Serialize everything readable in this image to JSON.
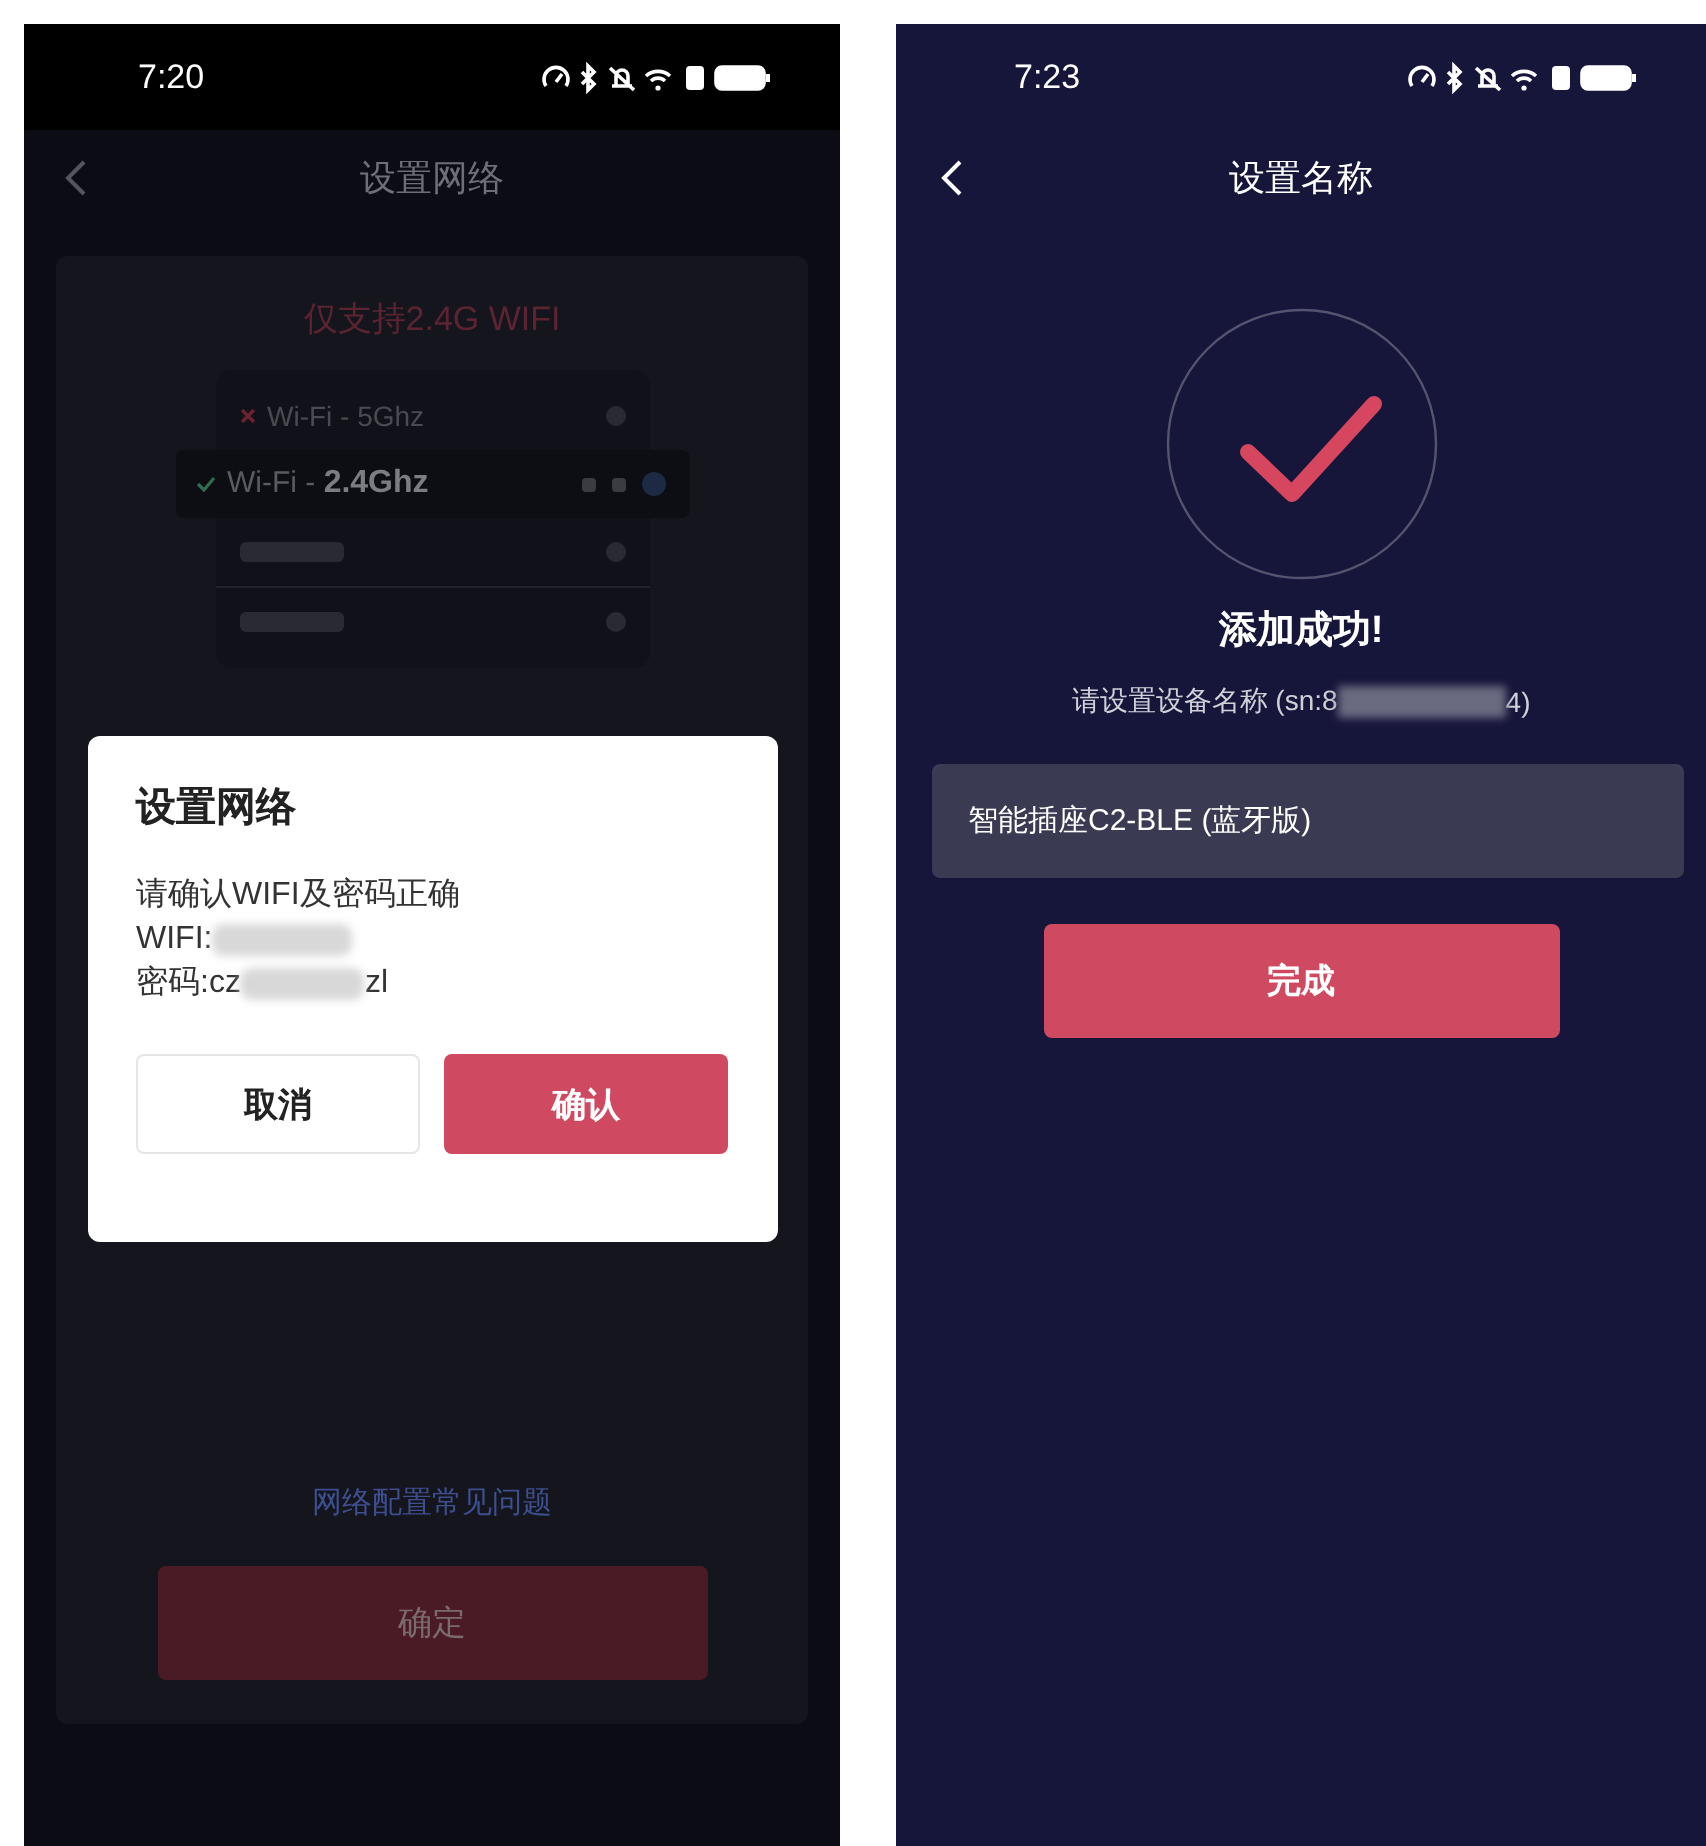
{
  "left_screen": {
    "status_bar": {
      "time": "7:20"
    },
    "header": {
      "title": "设置网络"
    },
    "notice": "仅支持2.4G WIFI",
    "wifi_list": [
      {
        "kind": "rejected",
        "label": "Wi-Fi - 5Ghz"
      },
      {
        "kind": "accepted",
        "label": "Wi-Fi - **2.4Ghz**"
      },
      {
        "kind": "blank"
      },
      {
        "kind": "blank"
      }
    ],
    "help_link": "网络配置常见问题",
    "submit_button": "确定",
    "dialog": {
      "title": "设置网络",
      "message": "请确认WIFI及密码正确",
      "wifi_label": "WIFI:",
      "password_start": "密码:cz",
      "password_end": "zl",
      "buttons": [
        {
          "kind": "secondary",
          "label": "取消"
        },
        {
          "kind": "primary",
          "label": "确认"
        }
      ]
    }
  },
  "right_screen": {
    "status_bar": {
      "time": "7:23"
    },
    "header": {
      "title": "设置名称"
    },
    "success_title": "添加成功!",
    "prompt_start": "请设置设备名称 (sn:8",
    "prompt_end": "4)",
    "name_field": {
      "value": "智能插座C2-BLE (蓝牙版)"
    },
    "done_button": "完成"
  }
}
